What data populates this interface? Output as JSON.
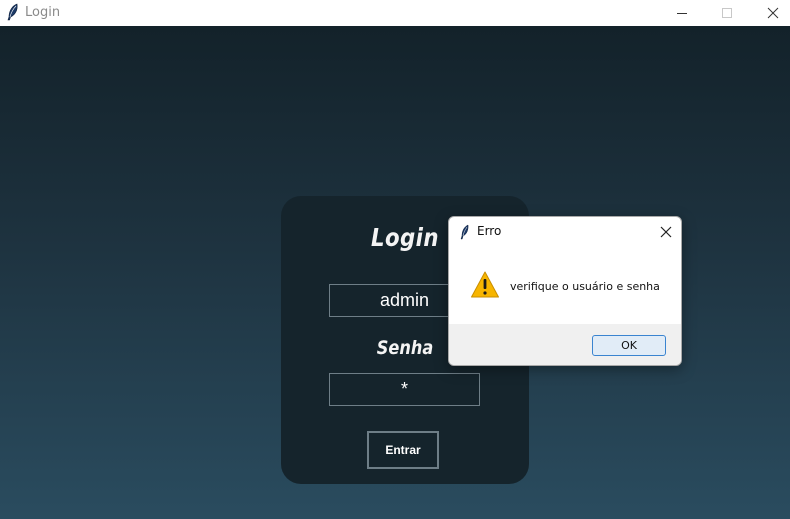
{
  "window": {
    "title": "Login",
    "icon": "feather-icon",
    "controls": [
      "minimize-icon",
      "maximize-icon",
      "close-icon"
    ]
  },
  "login_card": {
    "title": "Login",
    "username_value": "admin",
    "password_label": "Senha",
    "password_value": "*",
    "submit_label": "Entrar"
  },
  "dialog": {
    "title": "Erro",
    "icon": "feather-icon",
    "alert_icon": "warning-icon",
    "message": "verifique o usuário e senha",
    "ok_label": "OK"
  },
  "colors": {
    "background_top": "#13222a",
    "background_bottom": "#2a4c5f",
    "card": "#15242c",
    "text_light": "#f4f4f4",
    "field_border": "#6e7e87",
    "ok_button_border": "#3a84d0",
    "warning_yellow": "#f7b500"
  }
}
